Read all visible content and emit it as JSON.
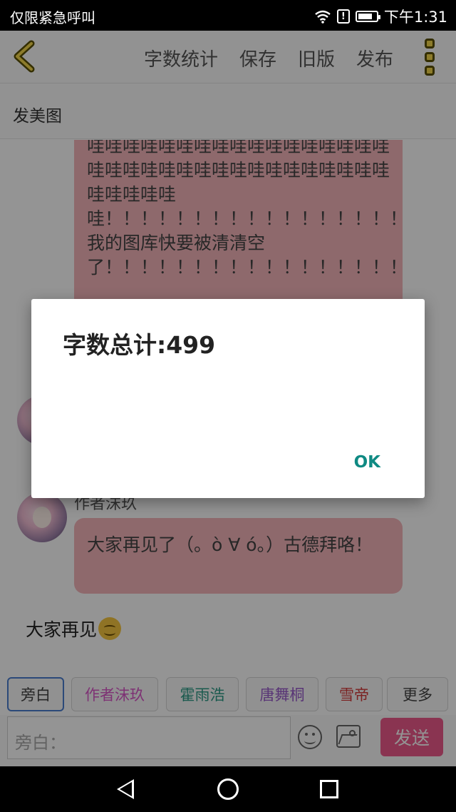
{
  "status_bar": {
    "carrier_text": "仅限紧急呼叫",
    "time": "下午1:31",
    "battery_level_percent": 80
  },
  "toolbar": {
    "items": [
      "字数统计",
      "保存",
      "旧版",
      "发布"
    ]
  },
  "subbar": {
    "title": "发美图"
  },
  "chat": {
    "bubble1_text": "哇哇哇哇哇哇哇哇哇哇哇哇哇哇哇哇哇哇哇哇哇哇哇哇哇哇哇哇哇哇哇哇哇哇哇哇哇哇哇哇！！！！！！！！！！！！！！！！！！！！！！！！！！！！！！！！！！！！！！！！！！！！我的图库快要被清清空了！！！！！！！！！！！！！！！！！！！！！！！！！！！！！！！！！！！！！！！！！",
    "author": "作者沫玖",
    "bubble2_text": "大家再见了（。ò ∀ ó。）古德拜咯！",
    "plain_text": "大家再见"
  },
  "roles": [
    {
      "label": "旁白",
      "color": "#444444",
      "selected": true
    },
    {
      "label": "作者沫玖",
      "color": "#d957c8"
    },
    {
      "label": "霍雨浩",
      "color": "#2b9a86"
    },
    {
      "label": "唐舞桐",
      "color": "#9a5ccc"
    },
    {
      "label": "雪帝",
      "color": "#d43a3a"
    },
    {
      "label": "更多",
      "color": "#444444"
    }
  ],
  "input": {
    "placeholder": "旁白：",
    "send_label": "发送"
  },
  "dialog": {
    "message": "字数总计:499",
    "ok_label": "OK"
  },
  "colors": {
    "bubble": "#f4b6bb",
    "send_button": "#ee5b8c",
    "dialog_ok": "#0f8a83",
    "menu_dots": "#f3d64b"
  }
}
